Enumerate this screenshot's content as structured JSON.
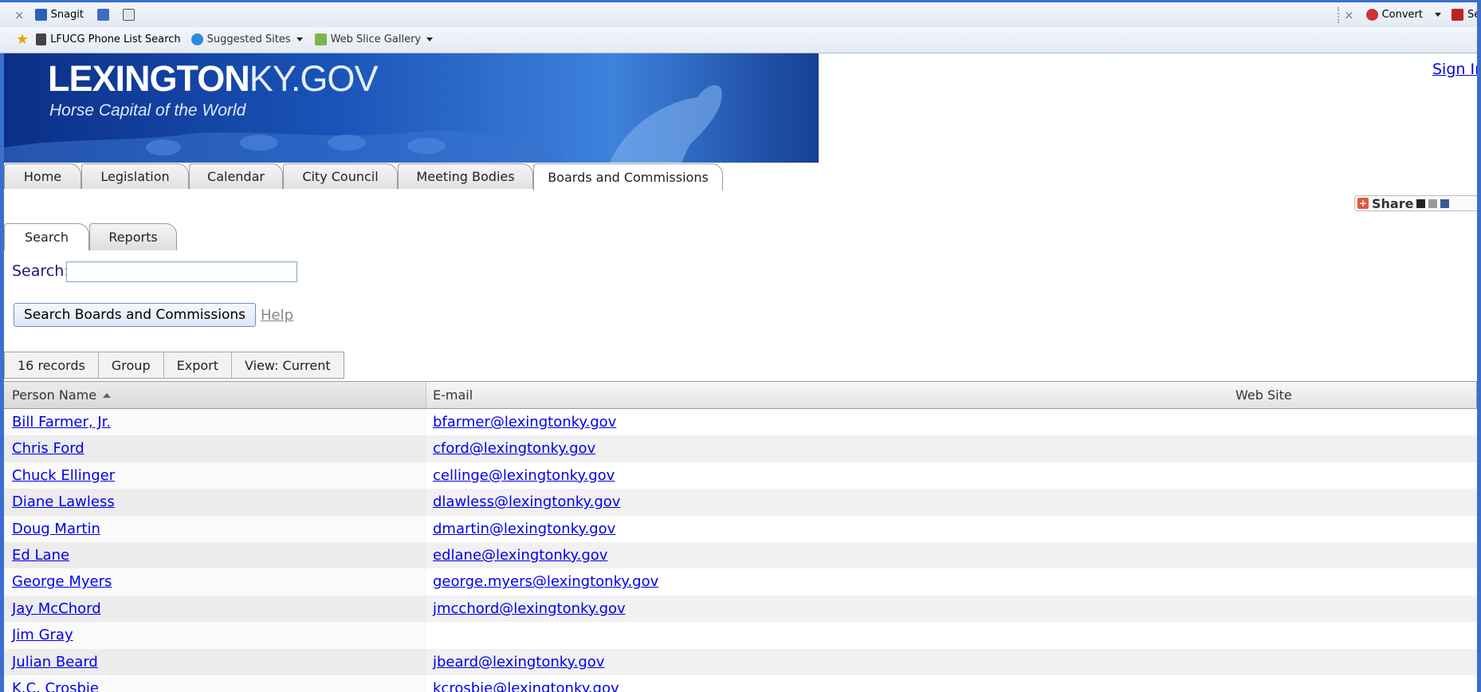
{
  "browser": {
    "toolbar1": {
      "close_glyph": "×",
      "snagit_label": "Snagit",
      "convert_label": "Convert",
      "sel_label": "Sele"
    },
    "toolbar2": {
      "fav1": "LFUCG Phone List Search",
      "fav2": "Suggested Sites",
      "fav3": "Web Slice Gallery"
    }
  },
  "site": {
    "logo_bold": "LEXINGTON",
    "logo_light": "KY.GOV",
    "tagline": "Horse Capital of the World",
    "signin": "Sign In",
    "share_label": "Share"
  },
  "main_tabs": [
    "Home",
    "Legislation",
    "Calendar",
    "City Council",
    "Meeting Bodies",
    "Boards and Commissions"
  ],
  "sub_tabs": [
    "Search",
    "Reports"
  ],
  "search": {
    "label": "Search:",
    "value": "",
    "button": "Search Boards and Commissions",
    "help": "Help"
  },
  "toolbar": {
    "records": "16 records",
    "group": "Group",
    "export": "Export",
    "view": "View: Current"
  },
  "grid": {
    "headers": {
      "name": "Person Name",
      "email": "E-mail",
      "website": "Web Site"
    },
    "rows": [
      {
        "name": "Bill Farmer, Jr.",
        "email": "bfarmer@lexingtonky.gov"
      },
      {
        "name": "Chris Ford",
        "email": "cford@lexingtonky.gov"
      },
      {
        "name": "Chuck Ellinger",
        "email": "cellinge@lexingtonky.gov"
      },
      {
        "name": "Diane Lawless",
        "email": "dlawless@lexingtonky.gov"
      },
      {
        "name": "Doug Martin",
        "email": "dmartin@lexingtonky.gov"
      },
      {
        "name": "Ed Lane",
        "email": "edlane@lexingtonky.gov"
      },
      {
        "name": "George Myers",
        "email": "george.myers@lexingtonky.gov"
      },
      {
        "name": "Jay McChord",
        "email": "jmcchord@lexingtonky.gov"
      },
      {
        "name": "Jim Gray",
        "email": ""
      },
      {
        "name": "Julian Beard",
        "email": "jbeard@lexingtonky.gov"
      },
      {
        "name": "K.C. Crosbie",
        "email": "kcrosbie@lexingtonky.gov"
      }
    ]
  },
  "colors": {
    "link": "#0000ee",
    "banner": "#1a53b8",
    "frame": "#3a6fd0"
  }
}
